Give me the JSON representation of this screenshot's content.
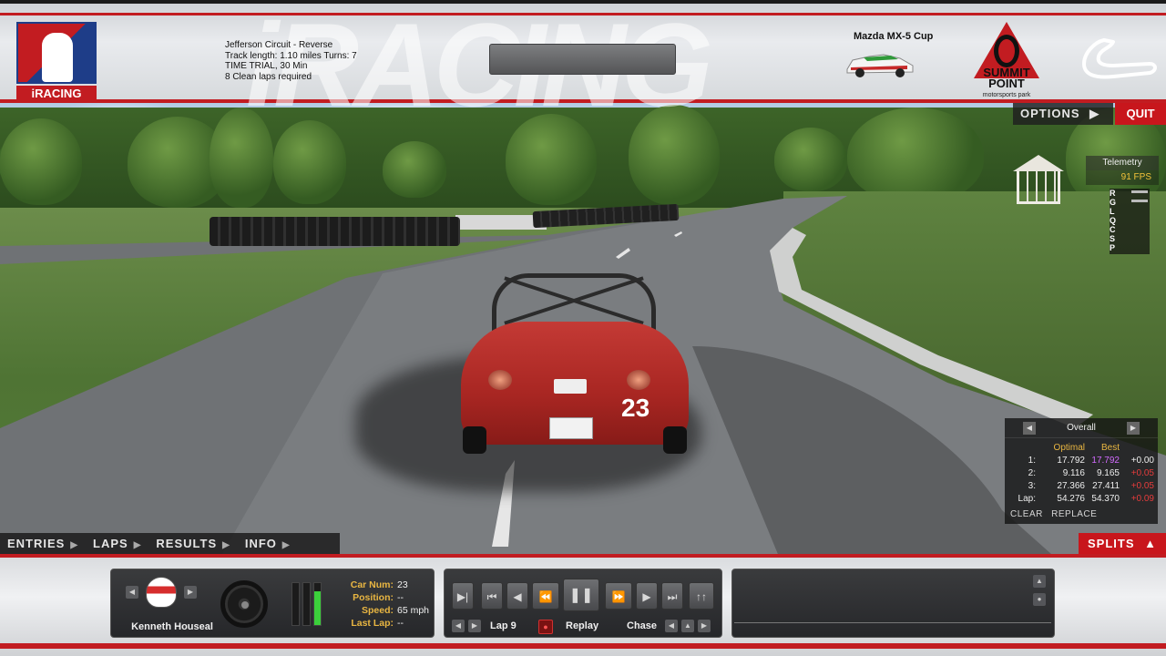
{
  "header": {
    "brand": "iRACING",
    "session": {
      "track": "Jefferson Circuit - Reverse",
      "track_info": "Track length: 1.10 miles Turns: 7",
      "mode": "TIME TRIAL, 30 Min",
      "requirement": "8 Clean laps required"
    },
    "center_button_label": "",
    "car_name": "Mazda MX-5 Cup",
    "track_logo_text": "SUMMIT POINT",
    "track_logo_sub": "motorsports park"
  },
  "top_menu": {
    "options_label": "OPTIONS",
    "quit_label": "QUIT"
  },
  "telemetry": {
    "title": "Telemetry",
    "fps": "91 FPS",
    "letters": [
      "R",
      "G",
      "L",
      "Q",
      "C",
      "S",
      "P"
    ]
  },
  "splits": {
    "title": "Overall",
    "col_optimal": "Optimal",
    "col_best": "Best",
    "rows": [
      {
        "label": "1:",
        "optimal": "17.792",
        "best": "17.792",
        "delta": "+0.00"
      },
      {
        "label": "2:",
        "optimal": "9.116",
        "best": "9.165",
        "delta": "+0.05"
      },
      {
        "label": "3:",
        "optimal": "27.366",
        "best": "27.411",
        "delta": "+0.05"
      },
      {
        "label": "Lap:",
        "optimal": "54.276",
        "best": "54.370",
        "delta": "+0.09"
      }
    ],
    "clear_label": "CLEAR",
    "replace_label": "REPLACE",
    "best_highlight_color": "#d36bff",
    "delta_color": "#e63c3c"
  },
  "bottom_tabs": {
    "entries": "ENTRIES",
    "laps": "LAPS",
    "results": "RESULTS",
    "info": "INFO",
    "splits_label": "SPLITS"
  },
  "driver_panel": {
    "driver_name": "Kenneth Houseal",
    "car_num_label": "Car Num:",
    "car_num": "23",
    "position_label": "Position:",
    "position": "--",
    "speed_label": "Speed:",
    "speed": "65 mph",
    "last_lap_label": "Last Lap:",
    "last_lap": "--",
    "throttle": 0.8,
    "brake": 0.0
  },
  "replay_panel": {
    "lap_label": "Lap 9",
    "replay_label": "Replay",
    "chase_label": "Chase",
    "state": "paused"
  },
  "car": {
    "number": "23"
  },
  "colors": {
    "accent_red": "#c21c21",
    "label_gold": "#e9b642",
    "throttle_green": "#3bd03b"
  }
}
